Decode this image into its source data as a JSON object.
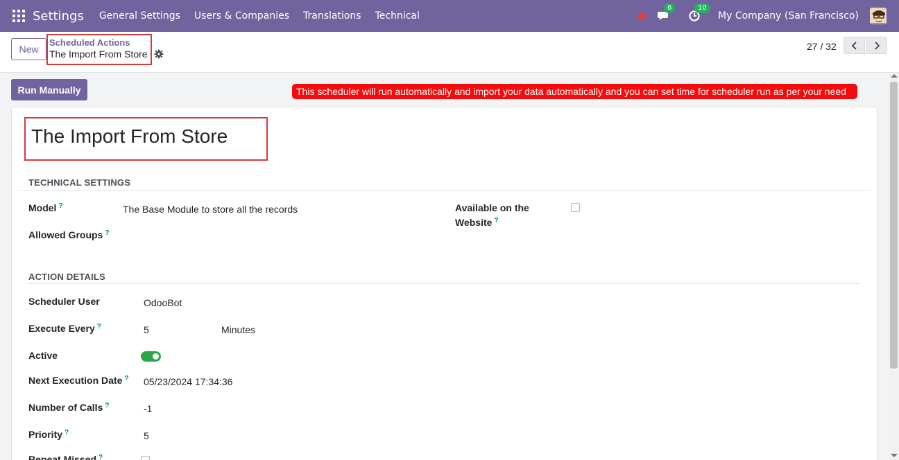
{
  "navbar": {
    "brand": "Settings",
    "menu": [
      "General Settings",
      "Users & Companies",
      "Translations",
      "Technical"
    ],
    "messages_badge": "6",
    "activities_badge": "10",
    "company": "My Company (San Francisco)"
  },
  "control": {
    "new_label": "New",
    "breadcrumb_parent": "Scheduled Actions",
    "breadcrumb_current": "The Import From Store",
    "pager": "27 / 32"
  },
  "actions": {
    "run_manually": "Run Manually",
    "note": "This scheduler will run automatically and import your data automatically and you can set time for scheduler run as per your need"
  },
  "record": {
    "title": "The Import From Store",
    "technical_settings": {
      "heading": "TECHNICAL SETTINGS",
      "model_label": "Model",
      "model_value": "The Base Module to store all the records",
      "allowed_groups_label": "Allowed Groups",
      "website_label_line1": "Available on the",
      "website_label_line2": "Website",
      "website_checked": false
    },
    "action_details": {
      "heading": "ACTION DETAILS",
      "scheduler_user_label": "Scheduler User",
      "scheduler_user_value": "OdooBot",
      "execute_every_label": "Execute Every",
      "execute_every_value": "5",
      "execute_every_unit": "Minutes",
      "active_label": "Active",
      "active_value": true,
      "next_exec_label": "Next Execution Date",
      "next_exec_value": "05/23/2024 17:34:36",
      "num_calls_label": "Number of Calls",
      "num_calls_value": "-1",
      "priority_label": "Priority",
      "priority_value": "5",
      "repeat_missed_label": "Repeat Missed"
    }
  },
  "help_mark": "?",
  "colors": {
    "brand": "#71639e",
    "note_bg": "#f50b0b",
    "toggle_on": "#28a745"
  }
}
